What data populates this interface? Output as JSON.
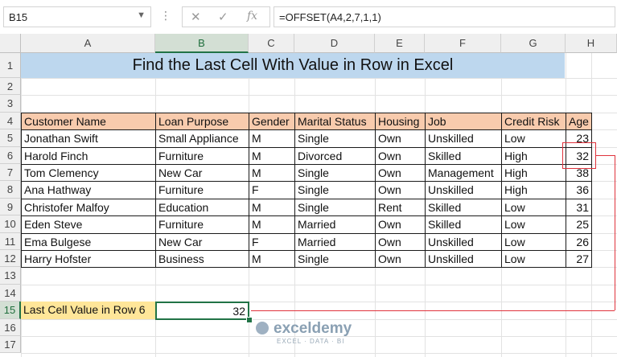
{
  "namebox": {
    "value": "B15"
  },
  "formula_bar": {
    "fx": "fx",
    "formula": "=OFFSET(A4,2,7,1,1)"
  },
  "columns": [
    "A",
    "B",
    "C",
    "D",
    "E",
    "F",
    "G",
    "H"
  ],
  "rows": [
    "1",
    "2",
    "3",
    "4",
    "5",
    "6",
    "7",
    "8",
    "9",
    "10",
    "11",
    "12",
    "13",
    "14",
    "15",
    "16",
    "17"
  ],
  "title": "Find the Last Cell With Value in Row in Excel",
  "table": {
    "headers": [
      "Customer Name",
      "Loan Purpose",
      "Gender",
      "Marital Status",
      "Housing",
      "Job",
      "Credit Risk",
      "Age"
    ],
    "rows": [
      [
        "Jonathan Swift",
        "Small Appliance",
        "M",
        "Single",
        "Own",
        "Unskilled",
        "Low",
        "23"
      ],
      [
        "Harold Finch",
        "Furniture",
        "M",
        "Divorced",
        "Own",
        "Skilled",
        "High",
        "32"
      ],
      [
        "Tom Clemency",
        "New Car",
        "M",
        "Single",
        "Own",
        "Management",
        "High",
        "38"
      ],
      [
        "Ana Hathway",
        "Furniture",
        "F",
        "Single",
        "Own",
        "Unskilled",
        "High",
        "36"
      ],
      [
        "Christofer Malfoy",
        "Education",
        "M",
        "Single",
        "Rent",
        "Skilled",
        "Low",
        "31"
      ],
      [
        "Eden Steve",
        "Furniture",
        "M",
        "Married",
        "Own",
        "Skilled",
        "Low",
        "25"
      ],
      [
        "Ema Bulgese",
        "New Car",
        "F",
        "Married",
        "Own",
        "Unskilled",
        "Low",
        "26"
      ],
      [
        "Harry Hofster",
        "Business",
        "M",
        "Single",
        "Own",
        "Unskilled",
        "Low",
        "27"
      ]
    ]
  },
  "result": {
    "label": "Last Cell Value in Row 6",
    "value": "32"
  },
  "watermark": {
    "name": "exceldemy",
    "tagline": "EXCEL · DATA · BI"
  },
  "colors": {
    "title_bg": "#bdd7ee",
    "header_bg": "#f8cbad",
    "label_bg": "#ffe699",
    "select": "#217346",
    "arrow": "#e0323c"
  }
}
